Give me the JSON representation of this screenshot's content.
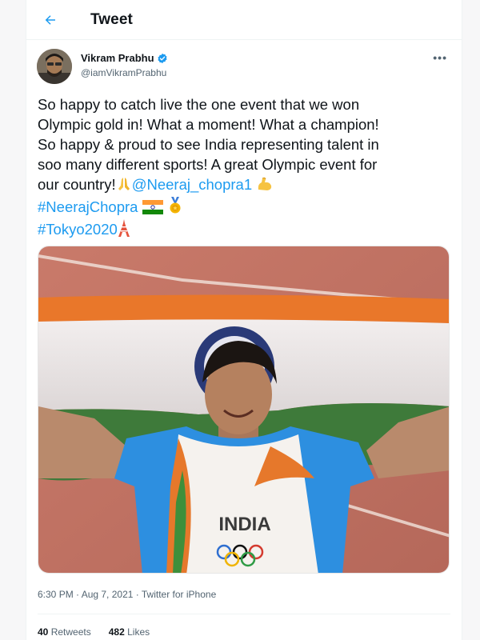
{
  "header": {
    "title": "Tweet"
  },
  "author": {
    "display_name": "Vikram Prabhu",
    "handle": "@iamVikramPrabhu"
  },
  "tweet": {
    "line1": "So happy to catch live the one event that we won",
    "line2": "Olympic gold in! What a moment! What a champion!",
    "line3": "So happy & proud to see India representing talent in",
    "line4": "soo many different sports! A great Olympic event for",
    "line5_text": "our country!",
    "mention": "@Neeraj_chopra1",
    "hashtag1": "#NeerajChopra",
    "hashtag2": "#Tokyo2020"
  },
  "media": {
    "jersey_text": "INDIA"
  },
  "meta": {
    "timestamp": "6:30 PM · Aug 7, 2021 · Twitter for iPhone"
  },
  "stats": {
    "retweets_count": "40",
    "retweets_label": "Retweets",
    "likes_count": "482",
    "likes_label": "Likes"
  },
  "icons": {
    "back": "arrow-left-icon",
    "verified": "verified-badge-icon",
    "more": "more-dots-icon",
    "pray": "folded-hands-emoji",
    "muscle": "flexed-biceps-emoji",
    "flag": "india-flag-emoji",
    "medal": "medal-emoji",
    "tower": "tokyo-tower-emoji"
  },
  "colors": {
    "accent": "#1d9bf0",
    "text": "#0f1419",
    "secondary": "#536471"
  }
}
